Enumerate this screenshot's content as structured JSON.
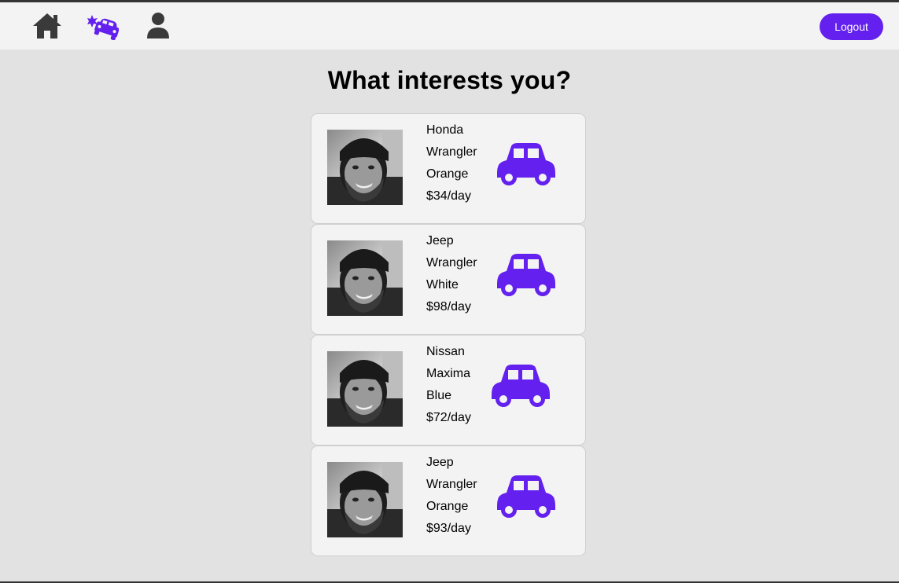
{
  "nav": {
    "items": [
      {
        "name": "home-icon",
        "color": "#3a3a3a"
      },
      {
        "name": "car-crash-icon",
        "color": "#6320ee",
        "active": true
      },
      {
        "name": "user-icon",
        "color": "#3a3a3a"
      }
    ],
    "logout_label": "Logout",
    "accent_color": "#6320ee"
  },
  "page": {
    "title": "What interests you?"
  },
  "listings": [
    {
      "make": "Honda",
      "model": "Wrangler",
      "color": "Orange",
      "price": "$34/day",
      "photo_icon": "person-photo",
      "car_icon": "car-icon"
    },
    {
      "make": "Jeep",
      "model": "Wrangler",
      "color": "White",
      "price": "$98/day",
      "photo_icon": "person-photo",
      "car_icon": "car-icon"
    },
    {
      "make": "Nissan",
      "model": "Maxima",
      "color": "Blue",
      "price": "$72/day",
      "photo_icon": "person-photo",
      "car_icon": "car-icon"
    },
    {
      "make": "Jeep",
      "model": "Wrangler",
      "color": "Orange",
      "price": "$93/day",
      "photo_icon": "person-photo",
      "car_icon": "car-icon"
    }
  ]
}
